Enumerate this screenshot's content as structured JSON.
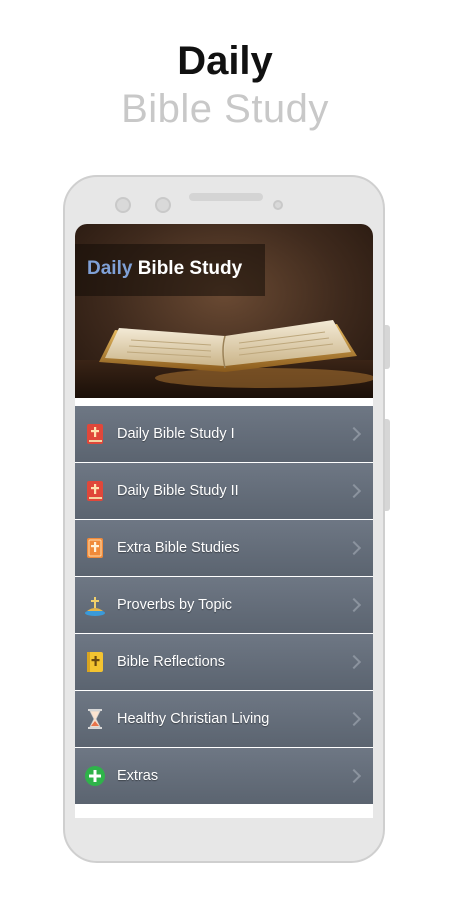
{
  "promo": {
    "title_line1": "Daily",
    "title_line2": "Bible Study"
  },
  "header": {
    "title_accent": "Daily",
    "title_rest": " Bible Study"
  },
  "menu": {
    "items": [
      {
        "label": "Daily Bible Study I",
        "icon": "red-book-cross-icon"
      },
      {
        "label": "Daily Bible Study II",
        "icon": "red-book-cross-icon"
      },
      {
        "label": "Extra Bible Studies",
        "icon": "orange-book-cross-icon"
      },
      {
        "label": "Proverbs by Topic",
        "icon": "cross-hill-icon"
      },
      {
        "label": "Bible Reflections",
        "icon": "yellow-book-cross-icon"
      },
      {
        "label": "Healthy Christian Living",
        "icon": "hourglass-icon"
      },
      {
        "label": "Extras",
        "icon": "green-plus-icon"
      }
    ]
  },
  "colors": {
    "accent_text": "#7fa0d6",
    "menu_bg": "#5b6470",
    "promo_subtitle": "#c8c8c8"
  }
}
